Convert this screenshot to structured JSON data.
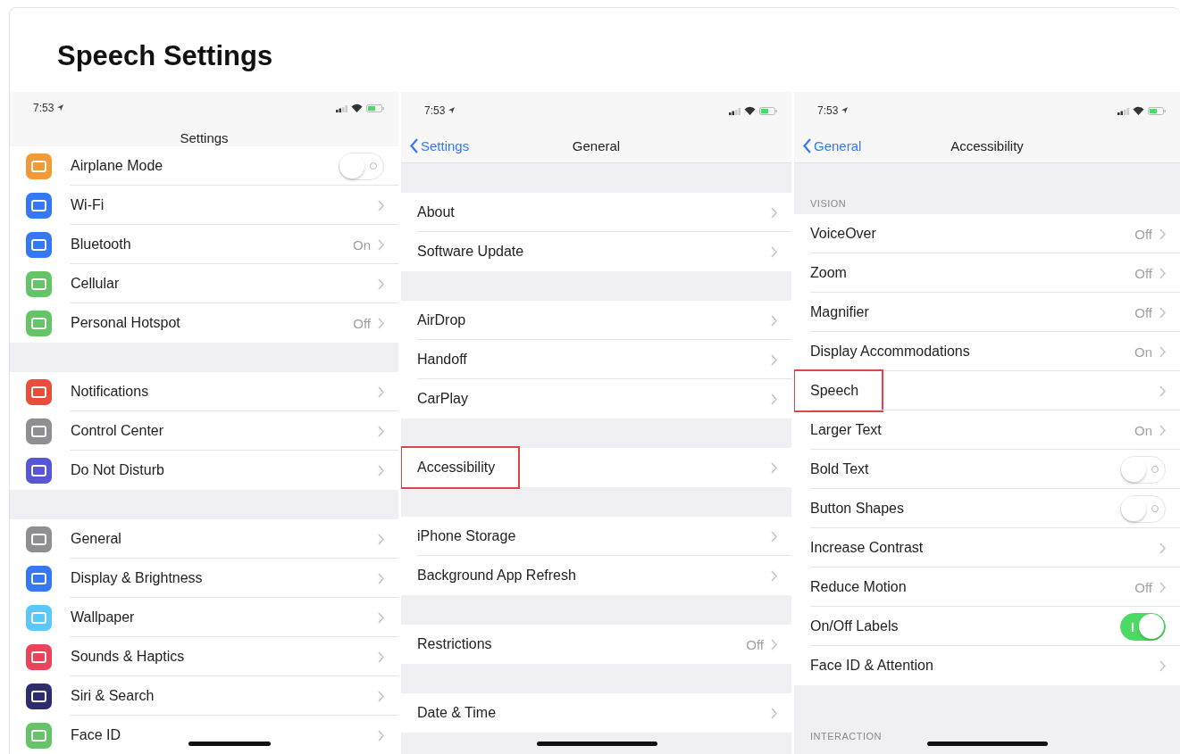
{
  "page_title": "Speech Settings",
  "panels": [
    {
      "status_time": "7:53",
      "nav": {
        "title": "Settings"
      },
      "groups": [
        {
          "rows": [
            {
              "label": "Airplane Mode",
              "kind": "toggle",
              "on": false,
              "highlighted": false,
              "color": "#f19a37"
            },
            {
              "label": "Wi-Fi",
              "kind": "link",
              "highlighted": false,
              "color": "#3478f6"
            },
            {
              "label": "Bluetooth",
              "kind": "link",
              "detail": "On",
              "highlighted": false,
              "color": "#3478f6"
            },
            {
              "label": "Cellular",
              "kind": "link",
              "highlighted": false,
              "color": "#65c466"
            },
            {
              "label": "Personal Hotspot",
              "kind": "link",
              "detail": "Off",
              "highlighted": false,
              "color": "#65c466"
            }
          ]
        },
        {
          "rows": [
            {
              "label": "Notifications",
              "kind": "link",
              "highlighted": false,
              "color": "#eb4d3d"
            },
            {
              "label": "Control Center",
              "kind": "link",
              "highlighted": false,
              "color": "#8e8e93"
            },
            {
              "label": "Do Not Disturb",
              "kind": "link",
              "highlighted": false,
              "color": "#5856d6"
            }
          ]
        },
        {
          "rows": [
            {
              "label": "General",
              "kind": "link",
              "highlighted": false,
              "color": "#8e8e93"
            },
            {
              "label": "Display & Brightness",
              "kind": "link",
              "highlighted": false,
              "color": "#3478f6"
            },
            {
              "label": "Wallpaper",
              "kind": "link",
              "highlighted": false,
              "color": "#5ac8fa"
            },
            {
              "label": "Sounds & Haptics",
              "kind": "link",
              "highlighted": false,
              "color": "#eb445a"
            },
            {
              "label": "Siri & Search",
              "kind": "link",
              "highlighted": false,
              "color": "#2c2c6e"
            },
            {
              "label": "Face ID",
              "kind": "link",
              "highlighted": false,
              "color": "#65c466"
            }
          ]
        }
      ]
    },
    {
      "status_time": "7:53",
      "nav": {
        "back": "Settings",
        "title": "General"
      },
      "groups": [
        {
          "rows": [
            {
              "label": "About",
              "kind": "link",
              "highlighted": false
            },
            {
              "label": "Software Update",
              "kind": "link",
              "highlighted": false
            }
          ]
        },
        {
          "rows": [
            {
              "label": "AirDrop",
              "kind": "link",
              "highlighted": false
            },
            {
              "label": "Handoff",
              "kind": "link",
              "highlighted": false
            },
            {
              "label": "CarPlay",
              "kind": "link",
              "highlighted": false
            }
          ]
        },
        {
          "rows": [
            {
              "label": "Accessibility",
              "kind": "link",
              "highlighted": true
            }
          ]
        },
        {
          "rows": [
            {
              "label": "iPhone Storage",
              "kind": "link",
              "highlighted": false
            },
            {
              "label": "Background App Refresh",
              "kind": "link",
              "highlighted": false
            }
          ]
        },
        {
          "rows": [
            {
              "label": "Restrictions",
              "kind": "link",
              "detail": "Off",
              "highlighted": false
            }
          ]
        },
        {
          "rows": [
            {
              "label": "Date & Time",
              "kind": "link",
              "highlighted": false
            }
          ]
        }
      ]
    },
    {
      "status_time": "7:53",
      "nav": {
        "back": "General",
        "title": "Accessibility"
      },
      "groups": [
        {
          "header": "VISION",
          "rows": [
            {
              "label": "VoiceOver",
              "kind": "link",
              "detail": "Off",
              "highlighted": false
            },
            {
              "label": "Zoom",
              "kind": "link",
              "detail": "Off",
              "highlighted": false
            },
            {
              "label": "Magnifier",
              "kind": "link",
              "detail": "Off",
              "highlighted": false
            },
            {
              "label": "Display Accommodations",
              "kind": "link",
              "detail": "On",
              "highlighted": false
            },
            {
              "label": "Speech",
              "kind": "link",
              "highlighted": true
            },
            {
              "label": "Larger Text",
              "kind": "link",
              "detail": "On",
              "highlighted": false
            },
            {
              "label": "Bold Text",
              "kind": "toggle",
              "on": false,
              "highlighted": false
            },
            {
              "label": "Button Shapes",
              "kind": "toggle",
              "on": false,
              "highlighted": false
            },
            {
              "label": "Increase Contrast",
              "kind": "link",
              "highlighted": false
            },
            {
              "label": "Reduce Motion",
              "kind": "link",
              "detail": "Off",
              "highlighted": false
            },
            {
              "label": "On/Off Labels",
              "kind": "toggle",
              "on": true,
              "highlighted": false
            },
            {
              "label": "Face ID & Attention",
              "kind": "link",
              "highlighted": false
            }
          ]
        },
        {
          "header": "INTERACTION"
        }
      ]
    }
  ]
}
